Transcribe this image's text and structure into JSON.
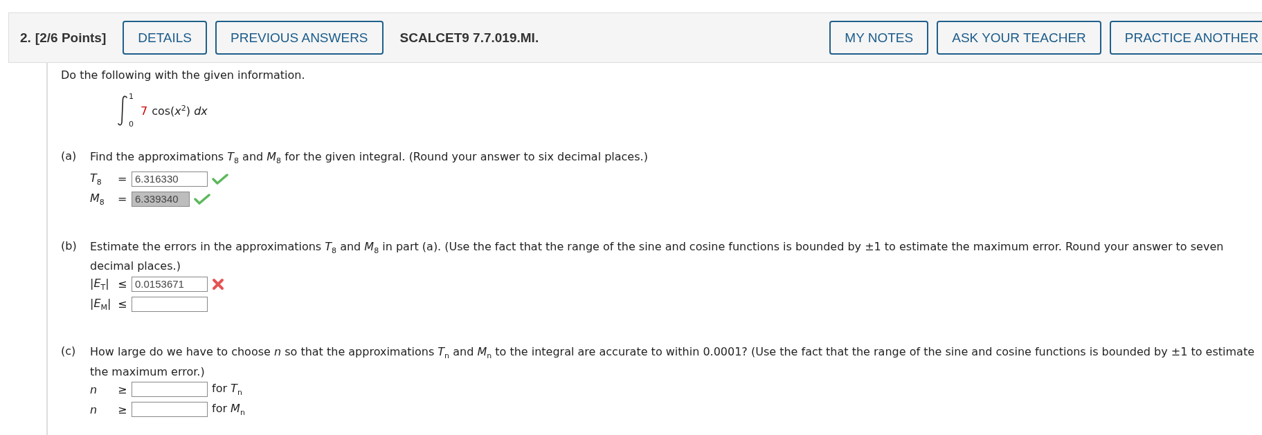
{
  "header": {
    "number": "2.",
    "points": "[2/6 Points]",
    "left_buttons": [
      {
        "label": "DETAILS"
      },
      {
        "label": "PREVIOUS ANSWERS"
      }
    ],
    "code": "SCALCET9 7.7.019.MI.",
    "right_buttons": [
      {
        "label": "MY NOTES"
      },
      {
        "label": "ASK YOUR TEACHER"
      },
      {
        "label": "PRACTICE ANOTHER"
      }
    ]
  },
  "intro": "Do the following with the given information.",
  "integral": {
    "upper": "1",
    "lower": "0",
    "coefficient": "7",
    "integrand": "cos(*x*$^{2}$) *dx*"
  },
  "parts": [
    {
      "letter": "(a)",
      "text": "Find the approximations *T*$_{8}$ and *M*$_{8}$ for the given integral. (Round your answer to six decimal places.)",
      "answers": [
        {
          "label": "*T*$_{8}$",
          "relation": "=",
          "value": "6.316330",
          "highlighted": false,
          "correct": true
        },
        {
          "label": "*M*$_{8}$",
          "relation": "=",
          "value": "6.339340",
          "highlighted": true,
          "correct": true
        }
      ]
    },
    {
      "letter": "(b)",
      "text": "Estimate the errors in the approximations *T*$_{8}$ and *M*$_{8}$ in part (a). (Use the fact that the range of the sine and cosine functions is bounded by ±1 to estimate the maximum error. Round your answer to seven decimal places.)",
      "answers": [
        {
          "label": "|*E*$_{T}$|",
          "relation": "≤",
          "value": "0.0153671",
          "highlighted": false,
          "correct": false
        },
        {
          "label": "|*E*$_{M}$|",
          "relation": "≤",
          "highlighted": false
        }
      ]
    },
    {
      "letter": "(c)",
      "text": "How large do we have to choose *n* so that the approximations *T*$_{n}$ and *M*$_{n}$ to the integral are accurate to within 0.0001? (Use the fact that the range of the sine and cosine functions is bounded by ±1 to estimate the maximum error.)",
      "answers": [
        {
          "label": "*n*",
          "relation": "≥",
          "highlighted": false,
          "suffix": "for *T*$_{n}$"
        },
        {
          "label": "*n*",
          "relation": "≥",
          "highlighted": false,
          "suffix": "for *M*$_{n}$"
        }
      ]
    }
  ]
}
